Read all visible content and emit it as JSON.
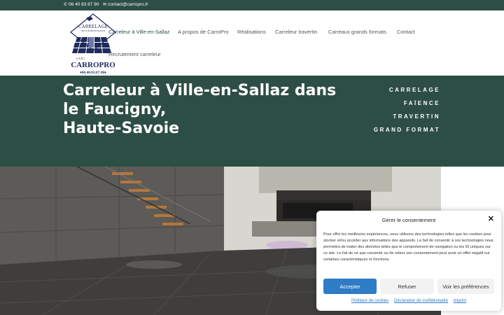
{
  "topbar": {
    "phone": "06 40 83 87 90",
    "email": "contact@carropro.fr"
  },
  "logo": {
    "line1": "CARRELAGE",
    "line2": "NEUF & RÉNOVATION",
    "sarl": "S A R L",
    "brand": "CARROPRO",
    "phone": "♦06.40.83.87.90♦"
  },
  "nav": {
    "items": [
      "Carreleur à Ville-en-Sallaz",
      "A propos de CarroPro",
      "Réalisations",
      "Carreleur travertin",
      "Carreaux grands formats",
      "Contact",
      "Recrutement carreleur"
    ]
  },
  "hero": {
    "title_lines": [
      "Carreleur à Ville-en-Sallaz dans",
      "le Faucigny,",
      "Haute-Savoie"
    ],
    "links": [
      "CARRELAGE",
      "FAÏENCE",
      "TRAVERTIN",
      "GRAND FORMAT"
    ]
  },
  "consent": {
    "title": "Gérer le consentement",
    "text": "Pour offrir les meilleures expériences, nous utilisons des technologies telles que les cookies pour stocker et/ou accéder aux informations des appareils. Le fait de consentir à ces technologies nous permettra de traiter des données telles que le comportement de navigation ou les ID uniques sur ce site. Le fait de ne pas consentir ou de retirer son consentement peut avoir un effet négatif sur certaines caractéristiques et fonctions.",
    "accept": "Accepter",
    "refuse": "Refuser",
    "preferences": "Voir les préférences",
    "links": [
      "Politique de cookies",
      "Déclaration de confidentialité",
      "Imprint"
    ]
  },
  "colors": {
    "brand_green": "#2d4e45",
    "accent_blue": "#2e7bc6",
    "logo_navy": "#1f2a5c"
  },
  "icons": {
    "phone": "phone-icon",
    "email": "envelope-icon",
    "close": "close-icon"
  }
}
